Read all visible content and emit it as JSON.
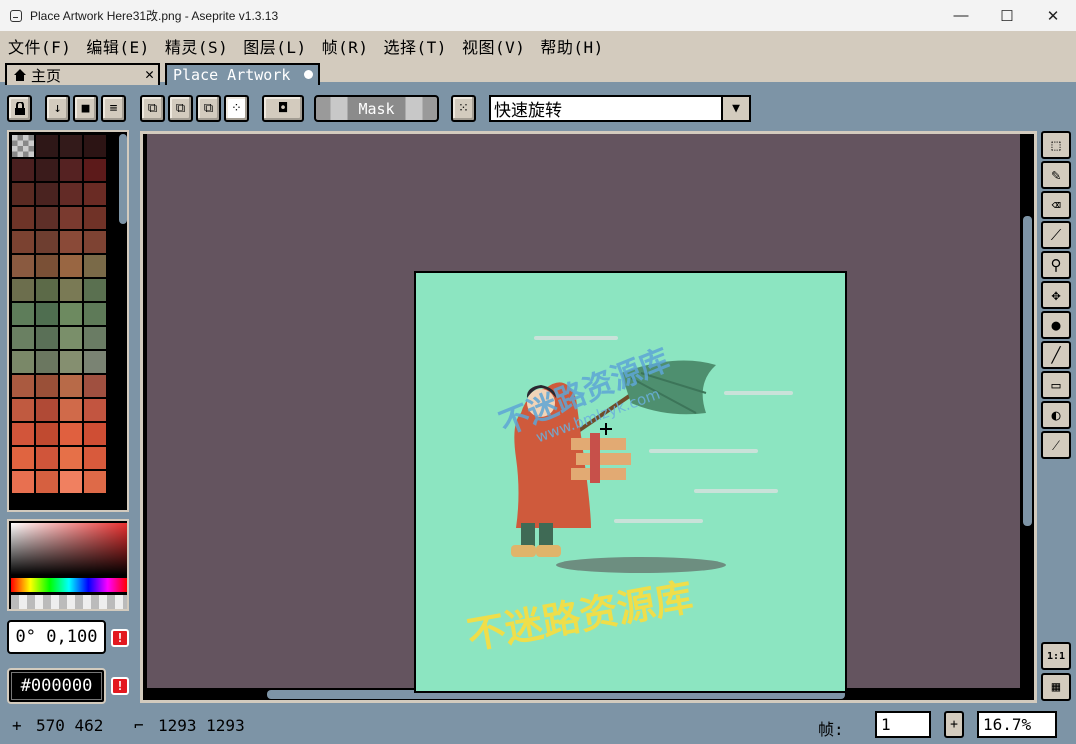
{
  "window": {
    "title": "Place Artwork Here31改.png - Aseprite v1.3.13",
    "minimize": "—",
    "maximize": "☐",
    "close": "✕"
  },
  "menu": [
    "文件(F)",
    "编辑(E)",
    "精灵(S)",
    "图层(L)",
    "帧(R)",
    "选择(T)",
    "视图(V)",
    "帮助(H)"
  ],
  "tabs": {
    "home": "主页",
    "doc": "Place Artwork"
  },
  "context": {
    "mask_label": "Mask",
    "ink_value": "快速旋转"
  },
  "color": {
    "angle": "0° 0,100",
    "hex": "#000000"
  },
  "status": {
    "cursor": "570 462",
    "size": "1293 1293",
    "frame_label": "帧:",
    "frame_value": "1",
    "zoom": "16.7%"
  },
  "artwork": {
    "watermark_top": "不迷路资源库",
    "watermark_url": "www.bmlzyk.com",
    "watermark_bottom": "不迷路资源库"
  },
  "palette_colors": [
    "#3b1c1c",
    "#2e1717",
    "#331a1a",
    "#2c1414",
    "#4a1f1f",
    "#3a1b1b",
    "#552222",
    "#5c1a1a",
    "#5a2a22",
    "#4a2320",
    "#632b26",
    "#6a2b24",
    "#6e3428",
    "#5e2f28",
    "#7a3a2f",
    "#703227",
    "#7b4231",
    "#6e3e30",
    "#8a4a38",
    "#7e4333",
    "#8a5a40",
    "#7a5036",
    "#996642",
    "#7a6a48",
    "#6c6e4d",
    "#5c6a48",
    "#7a7a55",
    "#5a7050",
    "#5e7d5a",
    "#4f6e50",
    "#6d8a60",
    "#5e7a58",
    "#6a8062",
    "#5a7057",
    "#7a8f6a",
    "#6a7c64",
    "#7a8868",
    "#6b7760",
    "#858f70",
    "#7a8373",
    "#aa5a40",
    "#9a5038",
    "#b86a48",
    "#a05040",
    "#c05a40",
    "#b04a36",
    "#d06a4a",
    "#c25540",
    "#d2553a",
    "#c04a30",
    "#e0603f",
    "#cf4e34",
    "#e06440",
    "#d0553a",
    "#e67048",
    "#d85a3c",
    "#e87050",
    "#d66040",
    "#f08060",
    "#de6a48"
  ]
}
